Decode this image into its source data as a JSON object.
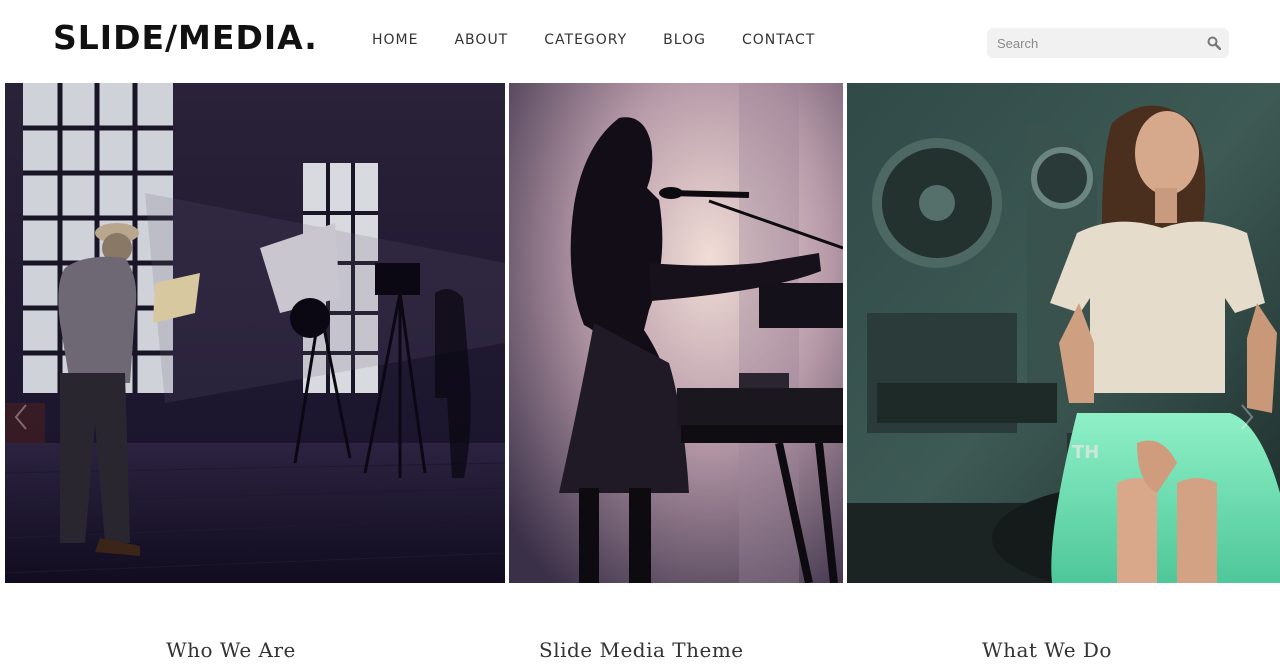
{
  "header": {
    "logo": "SLIDE/MEDIA.",
    "nav": [
      "HOME",
      "ABOUT",
      "CATEGORY",
      "BLOG",
      "CONTACT"
    ],
    "search": {
      "placeholder": "Search",
      "icon": "search-icon"
    }
  },
  "slides": [
    {
      "icon": "photo-studio-image"
    },
    {
      "icon": "singer-silhouette-image"
    },
    {
      "icon": "woman-sitting-image"
    }
  ],
  "carousel": {
    "prev_icon": "chevron-left-icon",
    "next_icon": "chevron-right-icon"
  },
  "captions": [
    "Who We Are",
    "Slide Media Theme",
    "What We Do"
  ],
  "colors": {
    "text": "#333333",
    "search_bg": "#f1f1f1",
    "accent_green": "#6fe0b4"
  }
}
